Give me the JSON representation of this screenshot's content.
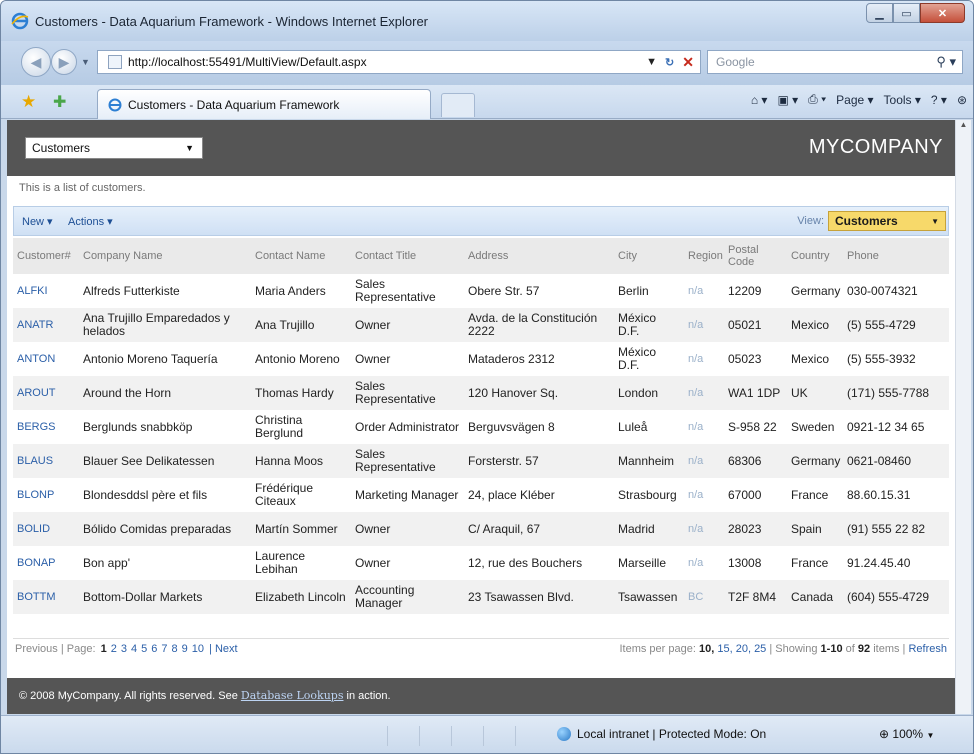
{
  "window": {
    "title": "Customers - Data Aquarium Framework - Windows Internet Explorer"
  },
  "browser": {
    "address": "http://localhost:55491/MultiView/Default.aspx",
    "search_placeholder": "Google",
    "tab_label": "Customers - Data Aquarium Framework",
    "commands": {
      "page": "Page ▾",
      "tools": "Tools ▾"
    },
    "status_zone": "Local intranet | Protected Mode: On",
    "zoom": "100%"
  },
  "site": {
    "page_select": "Customers",
    "brand": "MYCOMPANY",
    "description": "This is a list of customers.",
    "menu_new": "New ▾",
    "menu_actions": "Actions ▾",
    "view_label": "View:",
    "view_value": "Customers",
    "footer_text": "© 2008 MyCompany. All rights reserved. See ",
    "footer_link": "Database Lookups",
    "footer_tail": " in action."
  },
  "grid": {
    "columns": [
      "Customer#",
      "Company Name",
      "Contact Name",
      "Contact Title",
      "Address",
      "City",
      "Region",
      "Postal Code",
      "Country",
      "Phone"
    ],
    "rows": [
      [
        "ALFKI",
        "Alfreds Futterkiste",
        "Maria Anders",
        "Sales Representative",
        "Obere Str. 57",
        "Berlin",
        "n/a",
        "12209",
        "Germany",
        "030-0074321"
      ],
      [
        "ANATR",
        "Ana Trujillo Emparedados y helados",
        "Ana Trujillo",
        "Owner",
        "Avda. de la Constitución 2222",
        "México D.F.",
        "n/a",
        "05021",
        "Mexico",
        "(5) 555-4729"
      ],
      [
        "ANTON",
        "Antonio Moreno Taquería",
        "Antonio Moreno",
        "Owner",
        "Mataderos 2312",
        "México D.F.",
        "n/a",
        "05023",
        "Mexico",
        "(5) 555-3932"
      ],
      [
        "AROUT",
        "Around the Horn",
        "Thomas Hardy",
        "Sales Representative",
        "120 Hanover Sq.",
        "London",
        "n/a",
        "WA1 1DP",
        "UK",
        "(171) 555-7788"
      ],
      [
        "BERGS",
        "Berglunds snabbköp",
        "Christina Berglund",
        "Order Administrator",
        "Berguvsvägen 8",
        "Luleå",
        "n/a",
        "S-958 22",
        "Sweden",
        "0921-12 34 65"
      ],
      [
        "BLAUS",
        "Blauer See Delikatessen",
        "Hanna Moos",
        "Sales Representative",
        "Forsterstr. 57",
        "Mannheim",
        "n/a",
        "68306",
        "Germany",
        "0621-08460"
      ],
      [
        "BLONP",
        "Blondesddsl père et fils",
        "Frédérique Citeaux",
        "Marketing Manager",
        "24, place Kléber",
        "Strasbourg",
        "n/a",
        "67000",
        "France",
        "88.60.15.31"
      ],
      [
        "BOLID",
        "Bólido Comidas preparadas",
        "Martín Sommer",
        "Owner",
        "C/ Araquil, 67",
        "Madrid",
        "n/a",
        "28023",
        "Spain",
        "(91) 555 22 82"
      ],
      [
        "BONAP",
        "Bon app'",
        "Laurence Lebihan",
        "Owner",
        "12, rue des Bouchers",
        "Marseille",
        "n/a",
        "13008",
        "France",
        "91.24.45.40"
      ],
      [
        "BOTTM",
        "Bottom-Dollar Markets",
        "Elizabeth Lincoln",
        "Accounting Manager",
        "23 Tsawassen Blvd.",
        "Tsawassen",
        "BC",
        "T2F 8M4",
        "Canada",
        "(604) 555-4729"
      ]
    ]
  },
  "pager": {
    "previous": "Previous",
    "page_label": "| Page:",
    "pages": [
      "1",
      "2",
      "3",
      "4",
      "5",
      "6",
      "7",
      "8",
      "9",
      "10"
    ],
    "next": "| Next",
    "items_per_page_label": "Items per page:",
    "sizes": [
      "10,",
      "15,",
      "20,",
      "25"
    ],
    "showing_prefix": "| Showing",
    "showing_range": "1-10",
    "of_label": "of",
    "total": "92",
    "items_label": "items |",
    "refresh": "Refresh"
  }
}
